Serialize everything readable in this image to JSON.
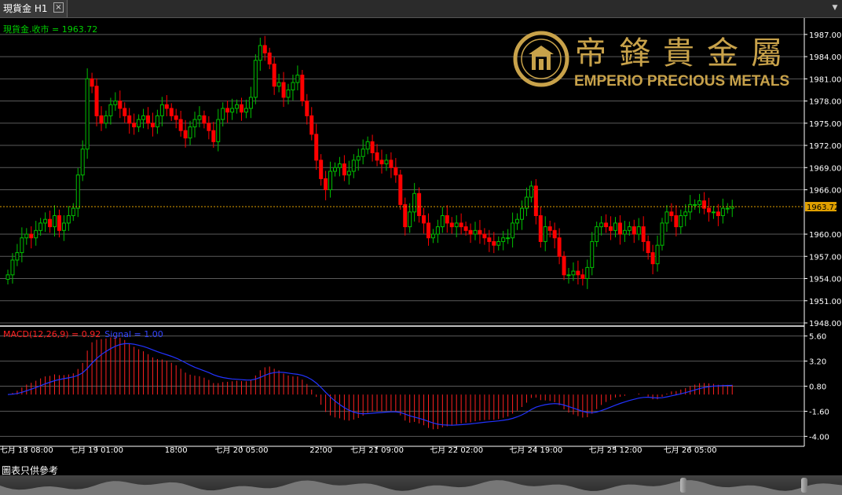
{
  "tab": {
    "title": "現貨金 H1",
    "close_label": "×",
    "menu_label": "▼"
  },
  "chart_data": {
    "type": "candlestick",
    "symbol_label": "現貨金.收市 = 1963.72",
    "current_price_label": "1963.72",
    "current_price": 1963.72,
    "ylim": [
      1948,
      1989
    ],
    "yticks": [
      "1987.00",
      "1984.00",
      "1981.00",
      "1978.00",
      "1975.00",
      "1972.00",
      "1969.00",
      "1966.00",
      "1960.00",
      "1957.00",
      "1954.00",
      "1951.00",
      "1948.00"
    ],
    "ytick_values": [
      1987,
      1984,
      1981,
      1978,
      1975,
      1972,
      1969,
      1966,
      1960,
      1957,
      1954,
      1951,
      1948
    ],
    "xticks": [
      "七月 18 08:00",
      "七月 19 01:00",
      "18:00",
      "七月 20 05:00",
      "22:00",
      "七月 21 09:00",
      "七月 22 02:00",
      "七月 24 19:00",
      "七月 25 12:00",
      "七月 26 05:00"
    ],
    "xtick_index": [
      4,
      19,
      36,
      50,
      67,
      79,
      96,
      113,
      130,
      146
    ],
    "up_color": "#00c000",
    "down_color": "#ff0000",
    "close": [
      1954.5,
      1956.5,
      1957.5,
      1959.5,
      1960.0,
      1959.5,
      1960.5,
      1961.5,
      1962.0,
      1961.0,
      1962.5,
      1960.5,
      1961.5,
      1962.5,
      1963.5,
      1968.0,
      1971.5,
      1981.0,
      1980.0,
      1976.0,
      1975.0,
      1976.0,
      1977.5,
      1978.0,
      1977.0,
      1976.0,
      1975.0,
      1974.5,
      1975.5,
      1976.0,
      1975.0,
      1974.5,
      1976.0,
      1977.5,
      1977.0,
      1976.0,
      1975.5,
      1974.0,
      1973.0,
      1974.5,
      1975.5,
      1976.0,
      1975.0,
      1974.0,
      1972.5,
      1975.5,
      1977.0,
      1976.5,
      1977.0,
      1977.5,
      1976.5,
      1977.0,
      1978.5,
      1983.5,
      1985.5,
      1984.5,
      1983.0,
      1980.0,
      1980.5,
      1978.5,
      1979.5,
      1980.5,
      1981.5,
      1978.0,
      1976.0,
      1973.5,
      1970.0,
      1967.5,
      1966.0,
      1968.5,
      1969.0,
      1969.5,
      1968.0,
      1968.5,
      1970.0,
      1970.5,
      1971.5,
      1972.5,
      1971.0,
      1970.0,
      1969.5,
      1970.0,
      1969.0,
      1968.0,
      1964.0,
      1961.0,
      1963.0,
      1965.5,
      1962.5,
      1961.5,
      1959.5,
      1960.0,
      1961.0,
      1962.5,
      1961.5,
      1961.0,
      1961.5,
      1961.0,
      1960.5,
      1960.0,
      1960.5,
      1960.0,
      1959.5,
      1959.0,
      1958.5,
      1959.0,
      1959.5,
      1959.5,
      1961.5,
      1962.0,
      1963.5,
      1965.0,
      1966.5,
      1962.5,
      1959.0,
      1961.0,
      1960.5,
      1959.5,
      1957.0,
      1954.5,
      1954.5,
      1955.0,
      1954.5,
      1954.0,
      1955.5,
      1959.0,
      1961.0,
      1961.5,
      1961.0,
      1960.5,
      1961.5,
      1960.0,
      1960.5,
      1961.0,
      1960.0,
      1961.0,
      1959.0,
      1957.5,
      1956.0,
      1958.5,
      1961.5,
      1963.0,
      1962.5,
      1961.0,
      1962.5,
      1963.0,
      1964.0,
      1964.0,
      1964.5,
      1963.5,
      1963.0,
      1963.0,
      1962.5,
      1963.5,
      1963.5,
      1963.72
    ],
    "macd": {
      "label": "MACD(12,26,9) = 0.92",
      "signal_label": "Signal = 1.00",
      "macd_color": "#ff2020",
      "signal_color": "#2233ff",
      "ylim": [
        -4.8,
        6.4
      ],
      "yticks": [
        "5.60",
        "3.20",
        "0.80",
        "-1.60",
        "-4.00"
      ],
      "ytick_values": [
        5.6,
        3.2,
        0.8,
        -1.6,
        -4.0
      ]
    }
  },
  "logo": {
    "chinese_name": "帝鋒貴金屬",
    "english_name": "EMPERIO PRECIOUS METALS",
    "gold_color": "#c8a24a"
  },
  "footer": {
    "disclaimer": "圖表只供參考"
  }
}
